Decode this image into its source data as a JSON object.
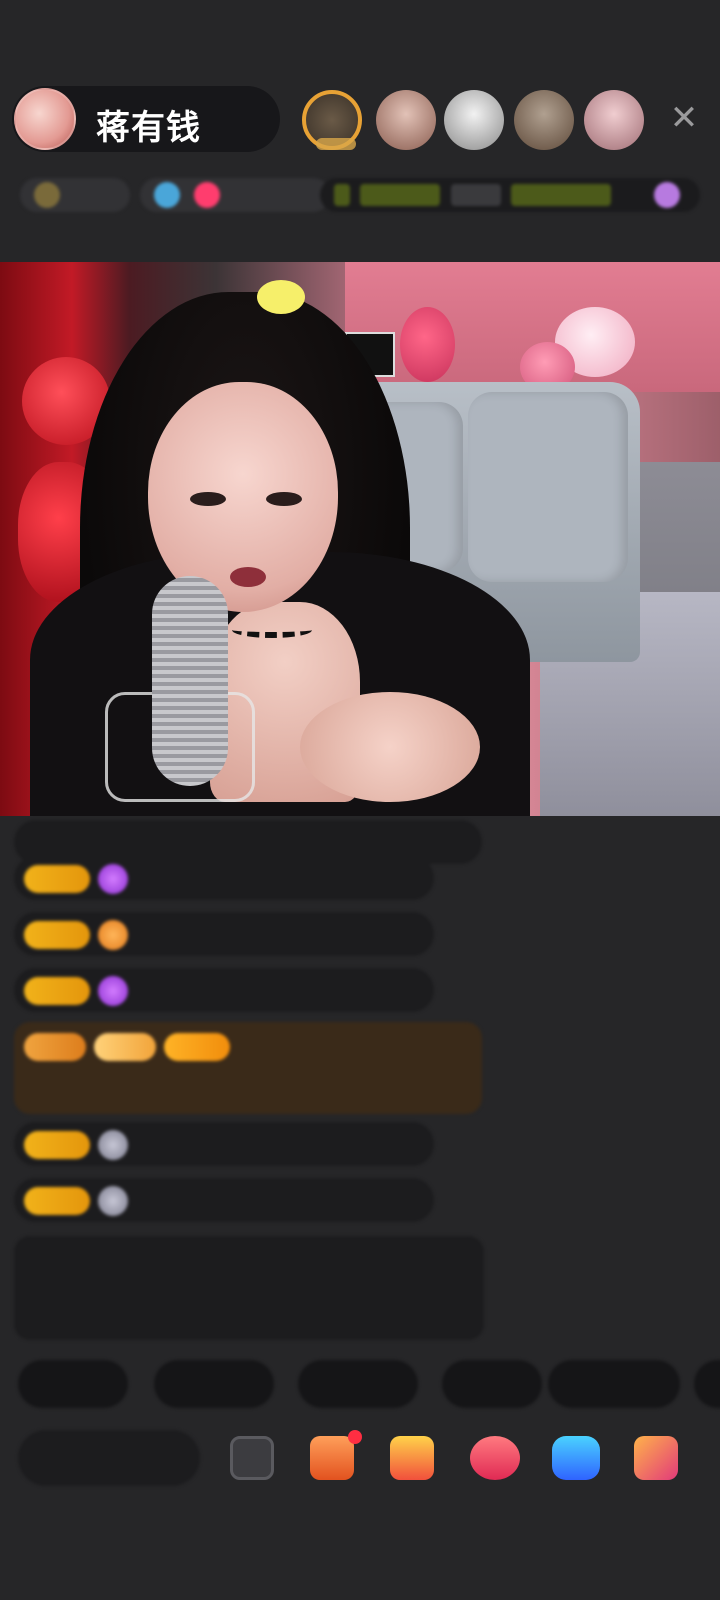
{
  "header": {
    "host_name": "蒋有钱",
    "viewer_count": 5,
    "close_icon": "close-icon"
  },
  "rank_row": {
    "chip1": "",
    "chip2": "",
    "chip3": ""
  },
  "chat": {
    "messages": [
      {
        "text": ""
      },
      {
        "user": "",
        "text": ""
      },
      {
        "user": "",
        "text": ""
      },
      {
        "user": "",
        "text": ""
      },
      {
        "user": "",
        "text": ""
      },
      {
        "user": "",
        "text": ""
      },
      {
        "user": "",
        "text": ""
      },
      {
        "text": ""
      }
    ]
  },
  "quick_replies": [
    "",
    "",
    "",
    "",
    "",
    ""
  ],
  "bottom_bar": {
    "say_placeholder": "",
    "icons": [
      "message-icon",
      "gift-box-icon",
      "shop-icon",
      "share-icon",
      "chat-bubble-icon",
      "more-games-icon"
    ]
  },
  "colors": {
    "background": "#262628",
    "level_badge": "#f1b21a",
    "accent_pink": "#ff2e42"
  }
}
